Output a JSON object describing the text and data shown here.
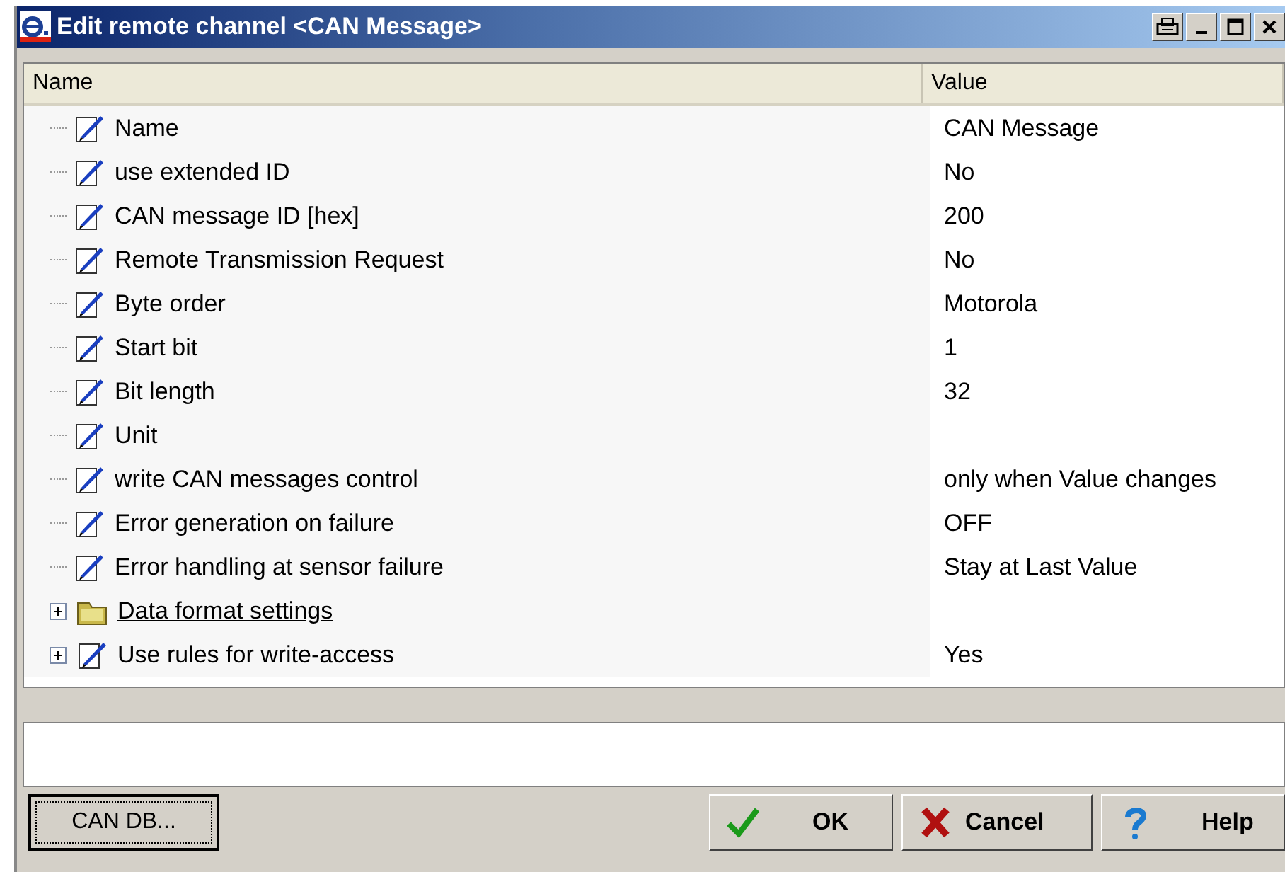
{
  "window": {
    "title": "Edit remote channel <CAN Message>"
  },
  "table": {
    "columns": [
      "Name",
      "Value"
    ],
    "rows": [
      {
        "kind": "property",
        "name": "Name",
        "value": "CAN Message"
      },
      {
        "kind": "property",
        "name": "use extended ID",
        "value": "No"
      },
      {
        "kind": "property",
        "name": "CAN message ID [hex]",
        "value": "200"
      },
      {
        "kind": "property",
        "name": "Remote Transmission Request",
        "value": "No"
      },
      {
        "kind": "property",
        "name": "Byte order",
        "value": "Motorola"
      },
      {
        "kind": "property",
        "name": "Start bit",
        "value": "1"
      },
      {
        "kind": "property",
        "name": "Bit length",
        "value": "32"
      },
      {
        "kind": "property",
        "name": "Unit"
      },
      {
        "kind": "property",
        "name": "write CAN messages control",
        "value": "only when Value changes"
      },
      {
        "kind": "property",
        "name": "Error generation on failure",
        "value": "OFF"
      },
      {
        "kind": "property",
        "name": "Error handling at sensor failure",
        "value": "Stay at Last Value"
      },
      {
        "kind": "folder",
        "name": "Data format settings",
        "expanded": false
      },
      {
        "kind": "property",
        "name": "Use rules for write-access",
        "value": "Yes",
        "expanded": false
      }
    ]
  },
  "buttons": [
    {
      "kind": "plain",
      "label": "CAN DB..."
    },
    {
      "kind": "ok",
      "label": "OK"
    },
    {
      "kind": "cancel",
      "label": "Cancel"
    },
    {
      "kind": "help",
      "label": "Help"
    }
  ]
}
